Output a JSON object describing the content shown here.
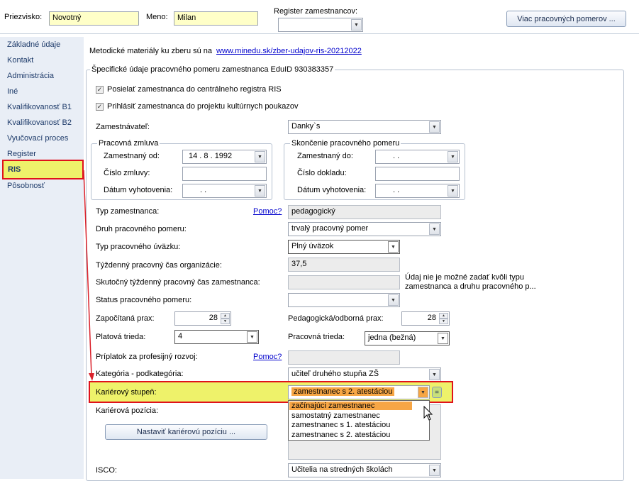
{
  "header": {
    "surname_label": "Priezvisko:",
    "surname_value": "Novotný",
    "name_label": "Meno:",
    "name_value": "Milan",
    "register_label": "Register zamestnancov:",
    "register_value": "",
    "more_button": "Viac pracovných pomerov ..."
  },
  "sidebar": {
    "items": [
      {
        "label": "Základné údaje"
      },
      {
        "label": "Kontakt"
      },
      {
        "label": "Administrácia"
      },
      {
        "label": "Iné"
      },
      {
        "label": "Kvalifikovanosť B1"
      },
      {
        "label": "Kvalifikovanosť B2"
      },
      {
        "label": "Vyučovací proces"
      },
      {
        "label": "Register"
      },
      {
        "label": "RIS"
      },
      {
        "label": "Pôsobnosť"
      }
    ],
    "selected": "RIS"
  },
  "main": {
    "method_text": "Metodické materiály ku zberu sú na",
    "method_link": "www.minedu.sk/zber-udajov-ris-20212022",
    "group_title": "Špecifické údaje pracovného pomeru zamestnanca EduID 930383357",
    "check1": "Posielať zamestnanca do centrálneho registra RIS",
    "check2": "Prihlásiť zamestnanca do projektu kultúrnych poukazov",
    "employer_label": "Zamestnávateľ:",
    "employer_value": "Danky`s",
    "contract": {
      "title": "Pracovná zmluva",
      "from_label": "Zamestnaný od:",
      "from_value": "14 .   8 .  1992",
      "number_label": "Číslo zmluvy:",
      "number_value": "",
      "date_label": "Dátum vyhotovenia:",
      "date_value": ".      ."
    },
    "termination": {
      "title": "Skončenie pracovného pomeru",
      "to_label": "Zamestnaný do:",
      "to_value": ".      .",
      "doc_label": "Číslo dokladu:",
      "doc_value": "",
      "date_label": "Dátum vyhotovenia:",
      "date_value": ".      ."
    },
    "type_label": "Typ zamestnanca:",
    "help1": "Pomoc?",
    "type_value": "pedagogický",
    "kind_label": "Druh pracovného pomeru:",
    "kind_value": "trvalý pracovný pomer",
    "load_label": "Typ pracovného úväzku:",
    "load_value": "Plný úväzok",
    "weekly_org_label": "Týždenný pracovný čas organizácie:",
    "weekly_org_value": "37,5",
    "weekly_emp_label": "Skutočný týždenný pracovný čas zamestnanca:",
    "weekly_emp_value": "",
    "weekly_note": "Údaj nie je možné zadať kvôli typu zamestnanca a druhu pracovného p...",
    "status_label": "Status pracovného pomeru:",
    "status_value": "",
    "practice_label": "Započítaná prax:",
    "practice_value": "28",
    "ped_practice_label": "Pedagogická/odborná prax:",
    "ped_practice_value": "28",
    "salary_label": "Platová trieda:",
    "salary_value": "4",
    "work_class_label": "Pracovná trieda:",
    "work_class_value": "jedna (bežná)",
    "bonus_label": "Príplatok za profesijný rozvoj:",
    "help2": "Pomoc?",
    "bonus_value": "",
    "category_label": "Kategória - podkategória:",
    "category_value": "učiteľ druhého stupňa ZŠ",
    "career_label": "Kariérový stupeň:",
    "career_value": "zamestnanec s 2. atestáciou",
    "career_eq": "=",
    "career_options": [
      "začínajúci zamestnanec",
      "samostatný zamestnanec",
      "zamestnanec s 1. atestáciou",
      "zamestnanec s 2. atestáciou"
    ],
    "position_label": "Kariérová pozícia:",
    "position_button": "Nastaviť kariérovú pozíciu ...",
    "isco_label": "ISCO:",
    "isco_value": "Učitelia na stredných školách"
  },
  "colors": {
    "highlight_yellow": "#eef26a",
    "highlight_border": "#e0121b",
    "selected_option": "#f7a645",
    "arrow": "#d9202a"
  }
}
